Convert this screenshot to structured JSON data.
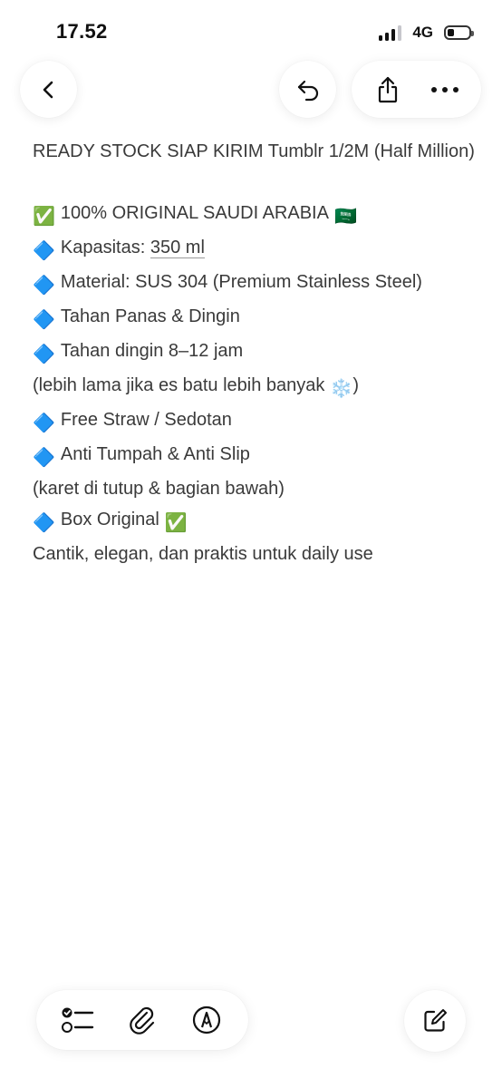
{
  "status_bar": {
    "time": "17.52",
    "network": "4G",
    "battery_level": 0.3
  },
  "nav": {
    "back_icon": "chevron-left-icon",
    "undo_icon": "undo-icon",
    "share_icon": "share-icon",
    "more_icon": "more-icon"
  },
  "note": {
    "title": "READY STOCK SIAP KIRIM Tumblr 1/2M (Half Million)",
    "lines": [
      {
        "prefix": "✅",
        "text": "100% ORIGINAL SAUDI ARABIA",
        "suffix": "🇸🇦"
      },
      {
        "prefix": "🔷",
        "text": "Kapasitas: ",
        "underlined": "350 ml"
      },
      {
        "prefix": "🔷",
        "text": "Material: SUS 304 (Premium Stainless Steel)"
      },
      {
        "prefix": "🔷",
        "text": "Tahan Panas & Dingin"
      },
      {
        "prefix": "🔷",
        "text": "Tahan dingin 8–12 jam"
      },
      {
        "text": "(lebih lama jika es batu lebih banyak",
        "suffix": "❄️",
        "closing": ")"
      },
      {
        "prefix": "🔷",
        "text": "Free Straw / Sedotan"
      },
      {
        "prefix": "🔷",
        "text": "Anti Tumpah & Anti Slip"
      },
      {
        "text": "(karet di tutup & bagian bawah)"
      },
      {
        "prefix": "🔷",
        "text": "Box Original",
        "suffix": "✅"
      },
      {
        "text": "Cantik, elegan, dan praktis untuk daily use"
      }
    ]
  },
  "toolbar": {
    "checklist_icon": "checklist-icon",
    "attachment_icon": "paperclip-icon",
    "markup_icon": "markup-pen-icon",
    "compose_icon": "compose-icon"
  }
}
